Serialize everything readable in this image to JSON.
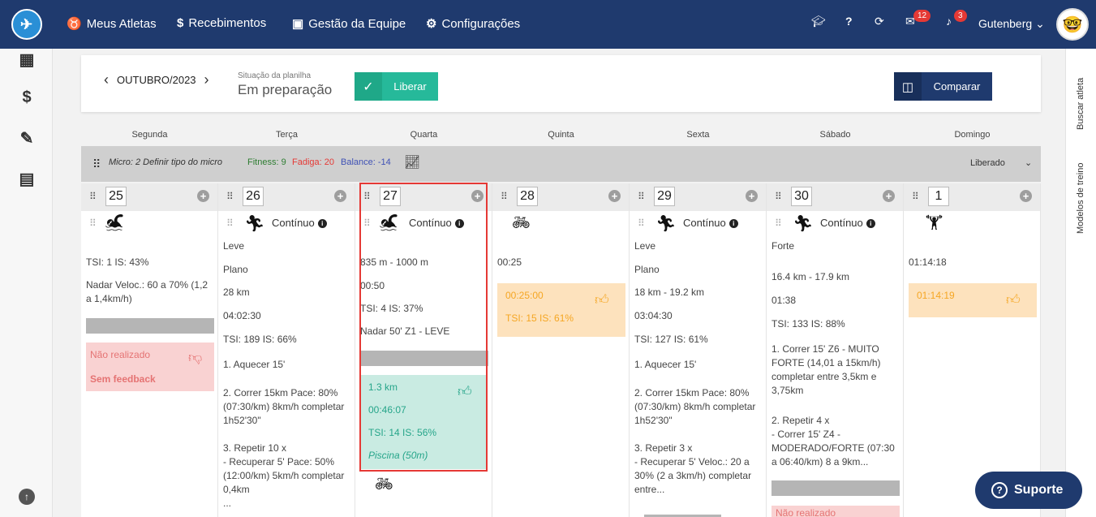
{
  "nav": {
    "items": [
      "Meus Atletas",
      "Recebimentos",
      "Gestão da Equipe",
      "Configurações"
    ],
    "icons": [
      "medal-icon",
      "dollar-icon",
      "team-icon",
      "gears-icon"
    ],
    "messages_badge": "12",
    "notifications_badge": "3",
    "user_name": "Gutenberg"
  },
  "rightbar": {
    "search_athlete": "Buscar atleta",
    "workout_templates": "Modelos de treino"
  },
  "header": {
    "month": "OUTUBRO/2023",
    "situation_label": "Situação da planilha",
    "situation_value": "Em preparação",
    "liberar": "Liberar",
    "comparar": "Comparar"
  },
  "weekdays": [
    "Segunda",
    "Terça",
    "Quarta",
    "Quinta",
    "Sexta",
    "Sábado",
    "Domingo"
  ],
  "micro": {
    "text": "Micro: 2 Definir tipo do micro",
    "fitness": "Fitness: 9",
    "fadiga": "Fadiga: 20",
    "balance": "Balance: -14",
    "status": "Liberado"
  },
  "days": [
    {
      "number": "25",
      "sport": "swim",
      "lines": [
        "TSI: 1 IS: 43%",
        "Nadar Veloc.: 60 a 70% (1,2 a 1,4km/h)"
      ],
      "feedback": {
        "status": "Não realizado",
        "note": "Sem feedback"
      }
    },
    {
      "number": "26",
      "sport": "run",
      "name": "Contínuo",
      "lines": [
        "Leve",
        "Plano",
        "28 km",
        "04:02:30",
        "TSI: 189 IS: 66%",
        "1. Aquecer 15'",
        "2. Correr 15km Pace: 80% (07:30/km) 8km/h completar 1h52'30\"",
        "3. Repetir 10 x\n- Recuperar 5' Pace: 50% (12:00/km) 5km/h completar 0,4km\n..."
      ]
    },
    {
      "number": "27",
      "sport": "swim",
      "name": "Contínuo",
      "lines": [
        "835 m - 1000 m",
        "00:50",
        "TSI: 4 IS: 37%",
        "Nadar 50' Z1 - LEVE"
      ],
      "feedback": {
        "distance": "1.3 km",
        "time": "00:46:07",
        "tsi": "TSI: 14 IS: 56%",
        "place": "Piscina (50m)"
      }
    },
    {
      "number": "28",
      "sport": "bike",
      "lines": [
        "00:25"
      ],
      "feedback": {
        "time": "00:25:00",
        "tsi": "TSI: 15 IS: 61%"
      }
    },
    {
      "number": "29",
      "sport": "run",
      "name": "Contínuo",
      "lines": [
        "Leve",
        "Plano",
        "18 km - 19.2 km",
        "03:04:30",
        "TSI: 127 IS: 61%",
        "1. Aquecer 15'",
        "2. Correr 15km Pace: 80% (07:30/km) 8km/h completar 1h52'30\"",
        "3. Repetir 3 x\n- Recuperar 5' Veloc.: 20 a 30% (2 a 3km/h) completar entre..."
      ]
    },
    {
      "number": "30",
      "sport": "run",
      "name": "Contínuo",
      "lines": [
        "Forte",
        "16.4 km - 17.9 km",
        "01:38",
        "TSI: 133 IS: 88%",
        "1. Correr 15' Z6 - MUITO FORTE (14,01 a 15km/h) completar entre 3,5km e 3,75km",
        "2. Repetir 4 x\n- Correr 15' Z4 - MODERADO/FORTE (07:30 a 06:40/km) 8 a 9km..."
      ],
      "feedback": {
        "status": "Não realizado"
      }
    },
    {
      "number": "1",
      "sport": "strength",
      "lines": [
        "01:14:18"
      ],
      "feedback": {
        "time": "01:14:19"
      }
    }
  ],
  "support": "Suporte"
}
